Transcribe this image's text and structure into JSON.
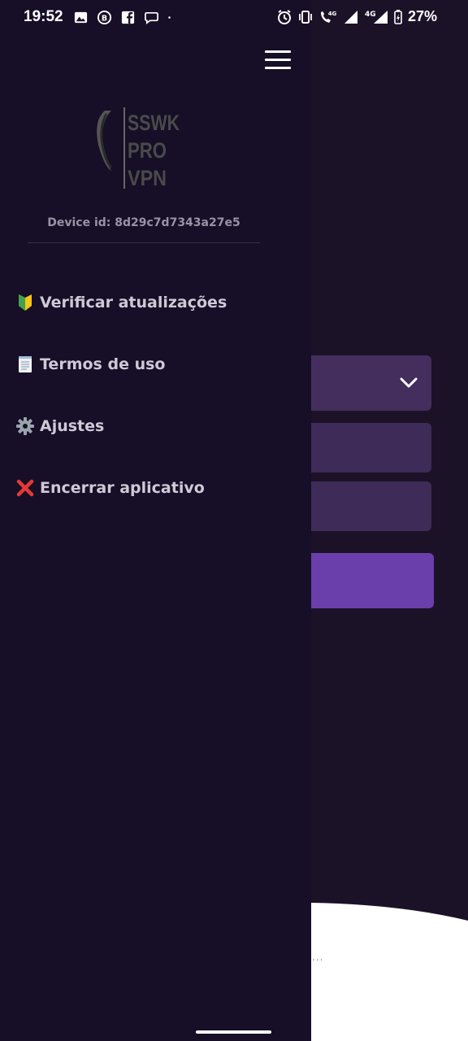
{
  "status_bar": {
    "time": "19:52",
    "battery_percent": "27%",
    "network_1": "4G",
    "network_2": "4G"
  },
  "drawer": {
    "device_id_label": "Device id: 8d29c7d7343a27e5",
    "logo_lines": [
      "SSWK",
      "PRO",
      "VPN"
    ],
    "menu": [
      {
        "icon": "beginner-shield-icon",
        "label": "Verificar atualizações"
      },
      {
        "icon": "document-icon",
        "label": "Termos de uso"
      },
      {
        "icon": "gear-icon",
        "label": "Ajustes"
      },
      {
        "icon": "close-cross-icon",
        "label": "Encerrar aplicativo"
      }
    ]
  },
  "background": {
    "dots": "..."
  },
  "colors": {
    "drawer_bg": "#170e27",
    "app_bg": "#1b1228",
    "field_bg": "#3e2b58",
    "dropdown_bg": "#432e5e",
    "button_bg": "#6a3eab"
  }
}
